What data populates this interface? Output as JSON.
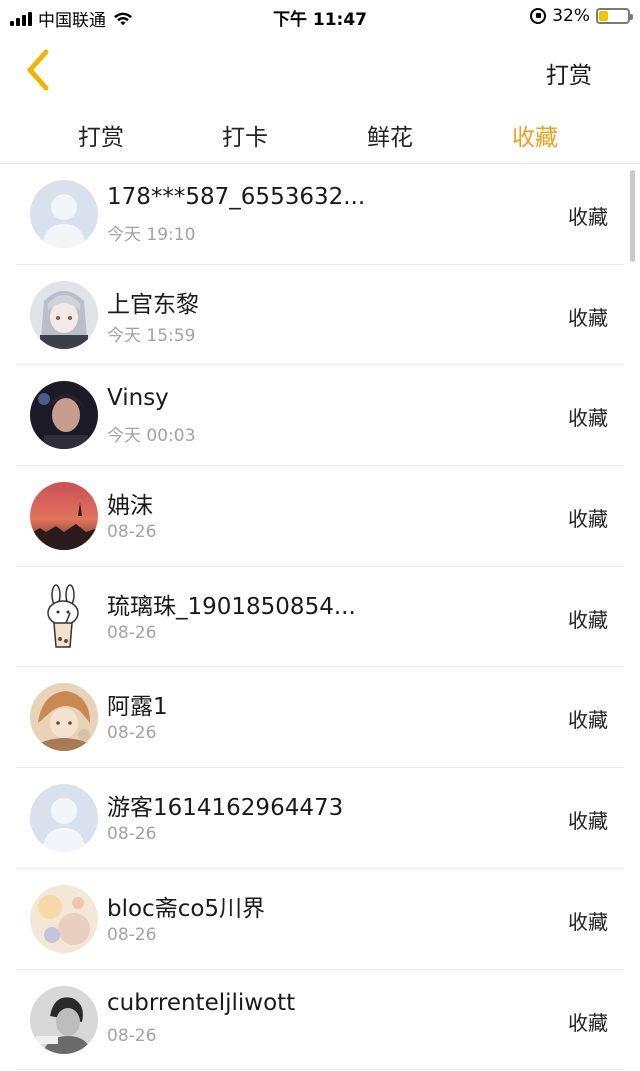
{
  "status_bar": {
    "carrier": "中国联通",
    "time": "下午 11:47",
    "battery": "32%",
    "battery_level": 0.32,
    "battery_color": "#f2c200"
  },
  "nav": {
    "back_icon": "chevron-left-icon",
    "back_color": "#f0b400",
    "action_label": "打赏"
  },
  "tabs": [
    {
      "label": "打赏",
      "active": false
    },
    {
      "label": "打卡",
      "active": false
    },
    {
      "label": "鲜花",
      "active": false
    },
    {
      "label": "收藏",
      "active": true
    }
  ],
  "accent_color": "#f0a020",
  "list": [
    {
      "name": "178***587_6553632...",
      "time": "今天 19:10",
      "action": "收藏",
      "avatar": "default-avatar"
    },
    {
      "name": "上官东黎",
      "time": "今天 15:59",
      "action": "收藏",
      "avatar": "anime-girl-avatar"
    },
    {
      "name": "Vinsy",
      "time": "今天 00:03",
      "action": "收藏",
      "avatar": "dark-portrait-avatar"
    },
    {
      "name": "姌沫",
      "time": "08-26",
      "action": "收藏",
      "avatar": "sunset-avatar"
    },
    {
      "name": "琉璃珠_1901850854...",
      "time": "08-26",
      "action": "收藏",
      "avatar": "bunny-avatar"
    },
    {
      "name": "阿露1",
      "time": "08-26",
      "action": "收藏",
      "avatar": "anime-boy-avatar"
    },
    {
      "name": "游客1614162964473",
      "time": "08-26",
      "action": "收藏",
      "avatar": "default-avatar"
    },
    {
      "name": "bloc斋co5川界",
      "time": "08-26",
      "action": "收藏",
      "avatar": "pastel-avatar"
    },
    {
      "name": "cubrrenteljliwott",
      "time": "08-26",
      "action": "收藏",
      "avatar": "bw-portrait-avatar"
    }
  ]
}
